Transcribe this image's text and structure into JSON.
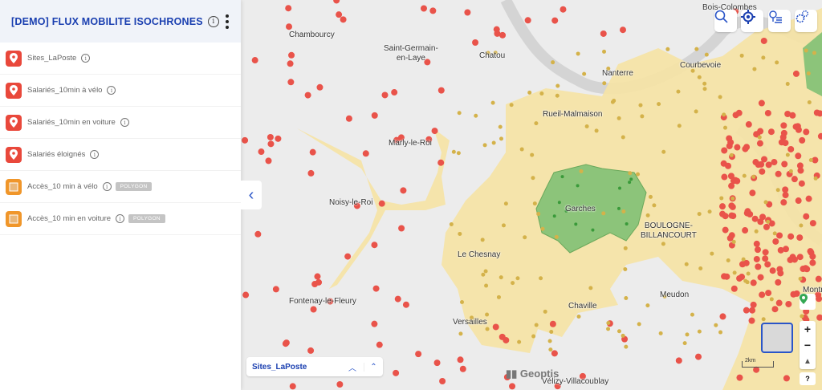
{
  "sidebar": {
    "title": "[DEMO] FLUX MOBILITE ISOCHRONES",
    "info": "i",
    "layers": [
      {
        "label": "Sites_LaPoste",
        "type": "point"
      },
      {
        "label": "Salariés_10min à vélo",
        "type": "point"
      },
      {
        "label": "Salariés_10min en voiture",
        "type": "point"
      },
      {
        "label": "Salariés éloignés",
        "type": "point"
      },
      {
        "label": "Accès_10 min à vélo",
        "type": "polygon",
        "badge": "POLYGON"
      },
      {
        "label": "Accès_10 min en voiture",
        "type": "polygon",
        "badge": "POLYGON"
      }
    ]
  },
  "map": {
    "cities": [
      "Bois-Colombes",
      "Chambourcy",
      "Saint-Germain-\nen-Laye",
      "Chatou",
      "Nanterre",
      "Courbevoie",
      "Rueil-Malmaison",
      "Marly-le-Roi",
      "Noisy-le-Roi",
      "Garches",
      "BOULOGNE-\nBILLANCOURT",
      "Le Chesnay",
      "Fontenay-le-Fleury",
      "Chaville",
      "Meudon",
      "Versailles",
      "Vélizy-Villacoublay",
      "Montr"
    ],
    "legend_label": "Sites_LaPoste",
    "attribution": "Geoptis",
    "scale": "2km",
    "help": "?",
    "zoom_in": "+",
    "zoom_out": "−"
  },
  "colors": {
    "accent": "#1a3fb0",
    "red": "#e9534a",
    "yellow": "#f6e3a4",
    "green": "#8cc47a"
  }
}
